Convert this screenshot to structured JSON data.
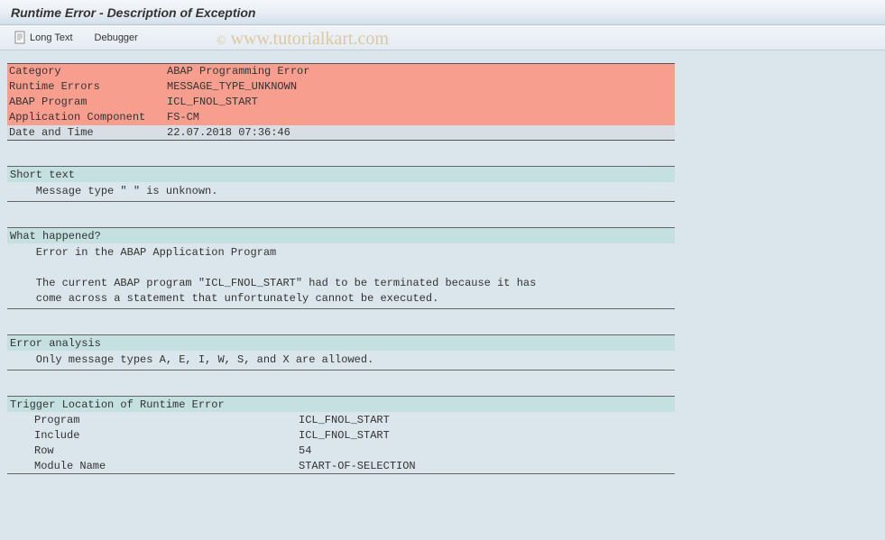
{
  "title": "Runtime Error - Description of Exception",
  "toolbar": {
    "long_text": "Long Text",
    "debugger": "Debugger"
  },
  "watermark": "www.tutorialkart.com",
  "info": {
    "rows": [
      {
        "label": "Category",
        "value": "ABAP Programming Error",
        "style": "red"
      },
      {
        "label": "Runtime Errors",
        "value": "MESSAGE_TYPE_UNKNOWN",
        "style": "red"
      },
      {
        "label": "ABAP Program",
        "value": "ICL_FNOL_START",
        "style": "red"
      },
      {
        "label": "Application Component",
        "value": "FS-CM",
        "style": "red"
      },
      {
        "label": "Date and Time",
        "value": "22.07.2018 07:36:46",
        "style": "gray"
      }
    ]
  },
  "sections": {
    "short_text": {
      "header": "Short text",
      "body": "    Message type \" \" is unknown."
    },
    "what_happened": {
      "header": "What happened?",
      "body": "    Error in the ABAP Application Program\n\n    The current ABAP program \"ICL_FNOL_START\" had to be terminated because it has\n    come across a statement that unfortunately cannot be executed."
    },
    "error_analysis": {
      "header": "Error analysis",
      "body": "    Only message types A, E, I, W, S, and X are allowed."
    },
    "trigger": {
      "header": "Trigger Location of Runtime Error",
      "rows": [
        {
          "label": "Program",
          "value": "ICL_FNOL_START"
        },
        {
          "label": "Include",
          "value": "ICL_FNOL_START"
        },
        {
          "label": "Row",
          "value": "54"
        },
        {
          "label": "Module Name",
          "value": "START-OF-SELECTION"
        }
      ]
    }
  }
}
